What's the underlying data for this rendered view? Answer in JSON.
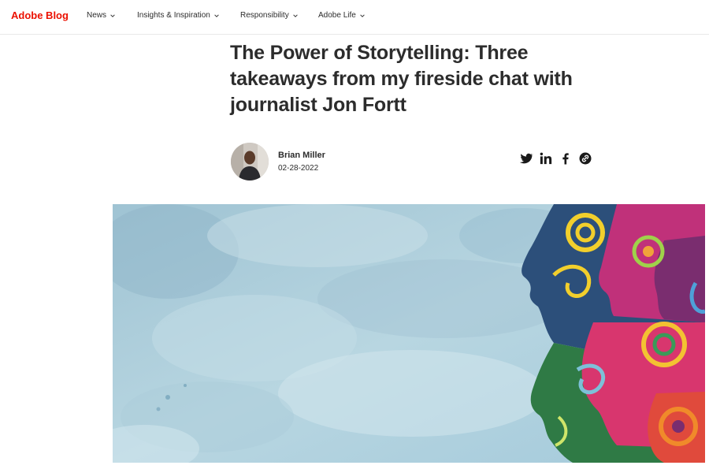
{
  "nav": {
    "brand": "Adobe Blog",
    "items": [
      {
        "label": "News"
      },
      {
        "label": "Insights & Inspiration"
      },
      {
        "label": "Responsibility"
      },
      {
        "label": "Adobe Life"
      }
    ]
  },
  "article": {
    "title": "The Power of Storytelling: Three takeaways from my fireside chat with journalist Jon Fortt",
    "author": "Brian Miller",
    "date": "02-28-2022"
  },
  "share": {
    "icons": [
      "twitter-icon",
      "linkedin-icon",
      "facebook-icon",
      "copy-link-icon"
    ]
  },
  "colors": {
    "brand": "#eb1000",
    "text": "#2c2c2c",
    "hero_sky": "#a9cbd8"
  }
}
